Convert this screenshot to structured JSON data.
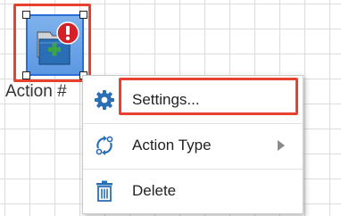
{
  "node": {
    "label": "Action #",
    "icon": "folder-plus-alert-icon",
    "badge": "!"
  },
  "context_menu": {
    "items": [
      {
        "label": "Settings...",
        "icon": "gear-icon",
        "highlighted": true
      },
      {
        "label": "Action Type",
        "icon": "action-type-icon",
        "has_submenu": true
      },
      {
        "label": "Delete",
        "icon": "trash-icon"
      }
    ]
  },
  "colors": {
    "highlight": "#e8412f",
    "selection": "#2b6fd6",
    "node_fill": "#6ea6e8",
    "icon_blue": "#2a6fb5",
    "alert_red": "#d42026",
    "plus_green": "#3aa34a"
  }
}
